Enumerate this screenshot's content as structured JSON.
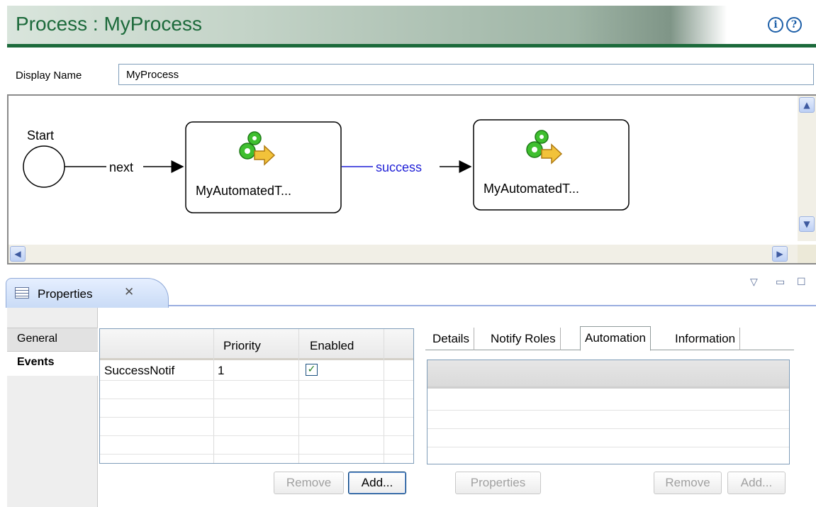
{
  "header": {
    "title": "Process : MyProcess",
    "info_icon": "info-icon",
    "help_icon": "help-icon",
    "info_glyph": "i",
    "help_glyph": "?"
  },
  "display_name": {
    "label": "Display Name",
    "value": "MyProcess"
  },
  "diagram": {
    "start_label": "Start",
    "edge1_label": "next",
    "edge2_label": "success",
    "node1_label": "MyAutomatedT...",
    "node2_label": "MyAutomatedT...",
    "node_icon": "gears-arrow-icon",
    "colors": {
      "edge2": "#1f1fd6",
      "gear": "#3fbf2f",
      "arrow": "#f2c23a"
    }
  },
  "properties_view": {
    "tab_label": "Properties",
    "tab_close_glyph": "✕",
    "menu_glyph": "▽",
    "minimize_glyph": "▭",
    "maximize_glyph": "☐"
  },
  "categories": {
    "general": "General",
    "events": "Events"
  },
  "events_table": {
    "columns": [
      "",
      "Priority",
      "Enabled"
    ],
    "rows": [
      {
        "name": "SuccessNotif",
        "priority": "1",
        "enabled": true
      }
    ],
    "check_glyph": "✓",
    "remove_button": "Remove",
    "add_button": "Add..."
  },
  "detail_tabs": {
    "items": [
      "Details",
      "Notify Roles",
      "Automation",
      "Information"
    ],
    "selected": "Automation",
    "properties_button": "Properties",
    "remove_button": "Remove",
    "add_button": "Add..."
  }
}
